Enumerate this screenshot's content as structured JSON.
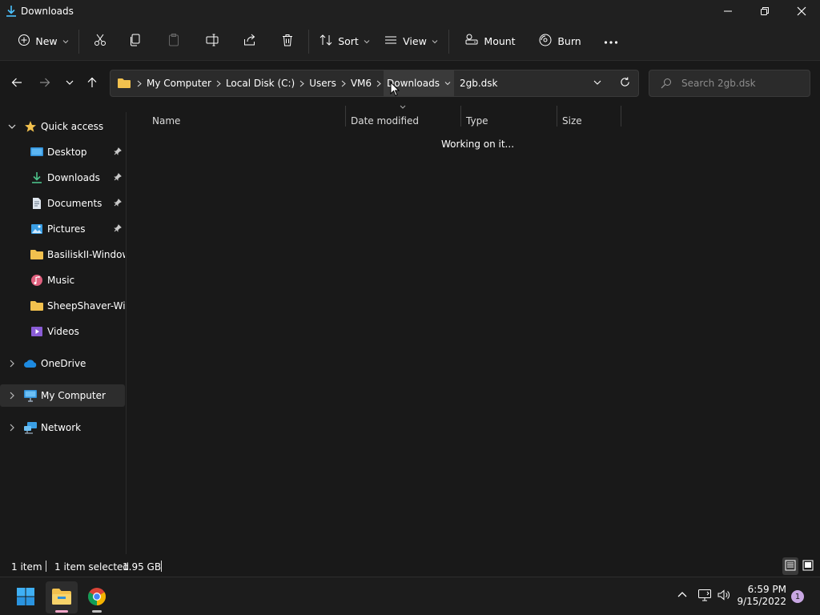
{
  "window": {
    "title": "Downloads"
  },
  "toolbar": {
    "new_label": "New",
    "sort_label": "Sort",
    "view_label": "View",
    "mount_label": "Mount",
    "burn_label": "Burn"
  },
  "breadcrumb": {
    "items": [
      "My Computer",
      "Local Disk (C:)",
      "Users",
      "VM6",
      "Downloads",
      "2gb.dsk"
    ]
  },
  "search": {
    "placeholder": "Search 2gb.dsk"
  },
  "sidebar": {
    "quick_access": "Quick access",
    "items": [
      {
        "label": "Desktop",
        "pinned": true
      },
      {
        "label": "Downloads",
        "pinned": true
      },
      {
        "label": "Documents",
        "pinned": true
      },
      {
        "label": "Pictures",
        "pinned": true
      },
      {
        "label": "BasiliskII-Windows",
        "pinned": false
      },
      {
        "label": "Music",
        "pinned": false
      },
      {
        "label": "SheepShaver-Windows",
        "pinned": false
      },
      {
        "label": "Videos",
        "pinned": false
      }
    ],
    "onedrive": "OneDrive",
    "my_computer": "My Computer",
    "network": "Network"
  },
  "columns": {
    "name": "Name",
    "date_modified": "Date modified",
    "type": "Type",
    "size": "Size"
  },
  "content": {
    "status": "Working on it..."
  },
  "statusbar": {
    "count": "1 item",
    "selection": "1 item selected",
    "size": "1.95 GB"
  },
  "taskbar": {
    "time": "6:59 PM",
    "date": "9/15/2022",
    "notifications": "1"
  },
  "colors": {
    "background": "#191919",
    "folder": "#f2c14e",
    "accent": "#4cc2ff"
  }
}
